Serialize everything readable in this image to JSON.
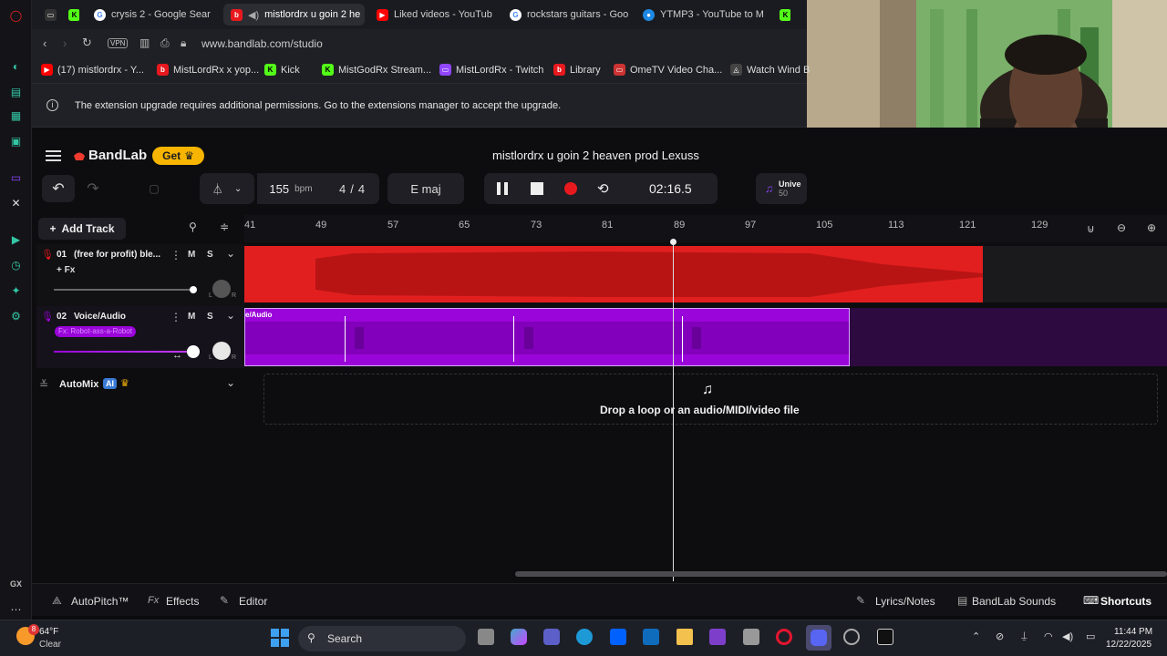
{
  "browser": {
    "tabs": [
      {
        "label": "crysis 2 - Google Sear",
        "icon": "google-icon"
      },
      {
        "label": "mistlordrx u goin 2 he",
        "icon": "bandlab-icon"
      },
      {
        "label": "Liked videos - YouTub",
        "icon": "youtube-icon"
      },
      {
        "label": "rockstars guitars - Goo",
        "icon": "google-icon"
      },
      {
        "label": "YTMP3 - YouTube to M",
        "icon": "ytmp3-icon"
      }
    ],
    "url": "www.bandlab.com/studio",
    "vpn": "VPN",
    "bookmarks": [
      "(17) mistlordrx - Y...",
      "MistLordRx x yop...",
      "Kick",
      "MistGodRx Stream...",
      "MistLordRx - Twitch",
      "Library",
      "OmeTV Video Cha...",
      "Watch Wind B"
    ],
    "notice": "The extension upgrade requires additional permissions. Go to the extensions manager to accept the upgrade."
  },
  "app": {
    "brand": "BandLab",
    "get_label": "Get",
    "project_title": "mistlordrx u goin 2 heaven prod Lexuss",
    "bpm": "155",
    "bpm_unit": "bpm",
    "time_sig_num": "4",
    "time_sig_slash": "/",
    "time_sig_den": "4",
    "key": "E maj",
    "time": "02:16.5",
    "promo_text": "Unive",
    "promo_sub": "50",
    "add_track": "Add Track",
    "ruler": [
      "41",
      "49",
      "57",
      "65",
      "73",
      "81",
      "89",
      "97",
      "105",
      "113",
      "121",
      "129"
    ],
    "tracks": [
      {
        "num": "01",
        "name": "(free for profit) ble...",
        "fx": "+ Fx",
        "m": "M",
        "s": "S",
        "color": "#e8191e"
      },
      {
        "num": "02",
        "name": "Voice/Audio",
        "fx": "Fx: Robot-ass-a-Robot",
        "m": "M",
        "s": "S",
        "color": "#9a05d9",
        "region": "e/Audio"
      }
    ],
    "automix": "AutoMix",
    "automix_badge": "AI",
    "drop_text": "Drop a loop or an audio/MIDI/video file",
    "footer_left": [
      "AutoPitch™",
      "Effects",
      "Editor"
    ],
    "footer_right": [
      "Lyrics/Notes",
      "BandLab Sounds",
      "Shortcuts"
    ],
    "pan_l": "L",
    "pan_r": "R"
  },
  "taskbar": {
    "temp": "64°F",
    "cond": "Clear",
    "search": "Search",
    "time": "11:44 PM",
    "date": "12/22/2025",
    "badge": "8"
  },
  "sidebar_bottom": "GX",
  "colors": {
    "red": "#e8191e",
    "purple": "#9a05d9",
    "orange": "#ff4433",
    "accent": "#f7b400"
  }
}
